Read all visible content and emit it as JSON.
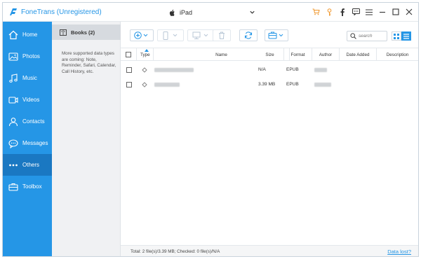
{
  "app": {
    "title": "FoneTrans (Unregistered)"
  },
  "device": {
    "name": "iPad"
  },
  "window_controls": [
    "cart-icon",
    "key-icon",
    "facebook-icon",
    "feedback-icon",
    "menu-icon",
    "minimize-icon",
    "maximize-icon",
    "close-icon"
  ],
  "sidebar": {
    "items": [
      {
        "label": "Home",
        "icon": "home-icon"
      },
      {
        "label": "Photos",
        "icon": "photos-icon"
      },
      {
        "label": "Music",
        "icon": "music-icon"
      },
      {
        "label": "Videos",
        "icon": "videos-icon"
      },
      {
        "label": "Contacts",
        "icon": "contacts-icon"
      },
      {
        "label": "Messages",
        "icon": "messages-icon"
      },
      {
        "label": "Others",
        "icon": "others-icon",
        "active": true
      },
      {
        "label": "Toolbox",
        "icon": "toolbox-icon"
      }
    ]
  },
  "category": {
    "selected": "Books (2)",
    "note": "More supported data types are coming: Note, Reminder, Safari, Calendar, Call History, etc."
  },
  "search": {
    "placeholder": "search"
  },
  "table": {
    "columns": [
      "Type",
      "Name",
      "Size",
      "Format",
      "Author",
      "Date Added",
      "Description"
    ],
    "rows": [
      {
        "size": "N/A",
        "format": "EPUB"
      },
      {
        "size": "3.39 MB",
        "format": "EPUB"
      }
    ]
  },
  "status": {
    "summary": "Total: 2 file(s)/3.39 MB; Checked: 0 file(s)/N/A",
    "data_lost_link": "Data lost?"
  },
  "colors": {
    "accent": "#2596e6",
    "active_nav": "#1a78c2"
  }
}
